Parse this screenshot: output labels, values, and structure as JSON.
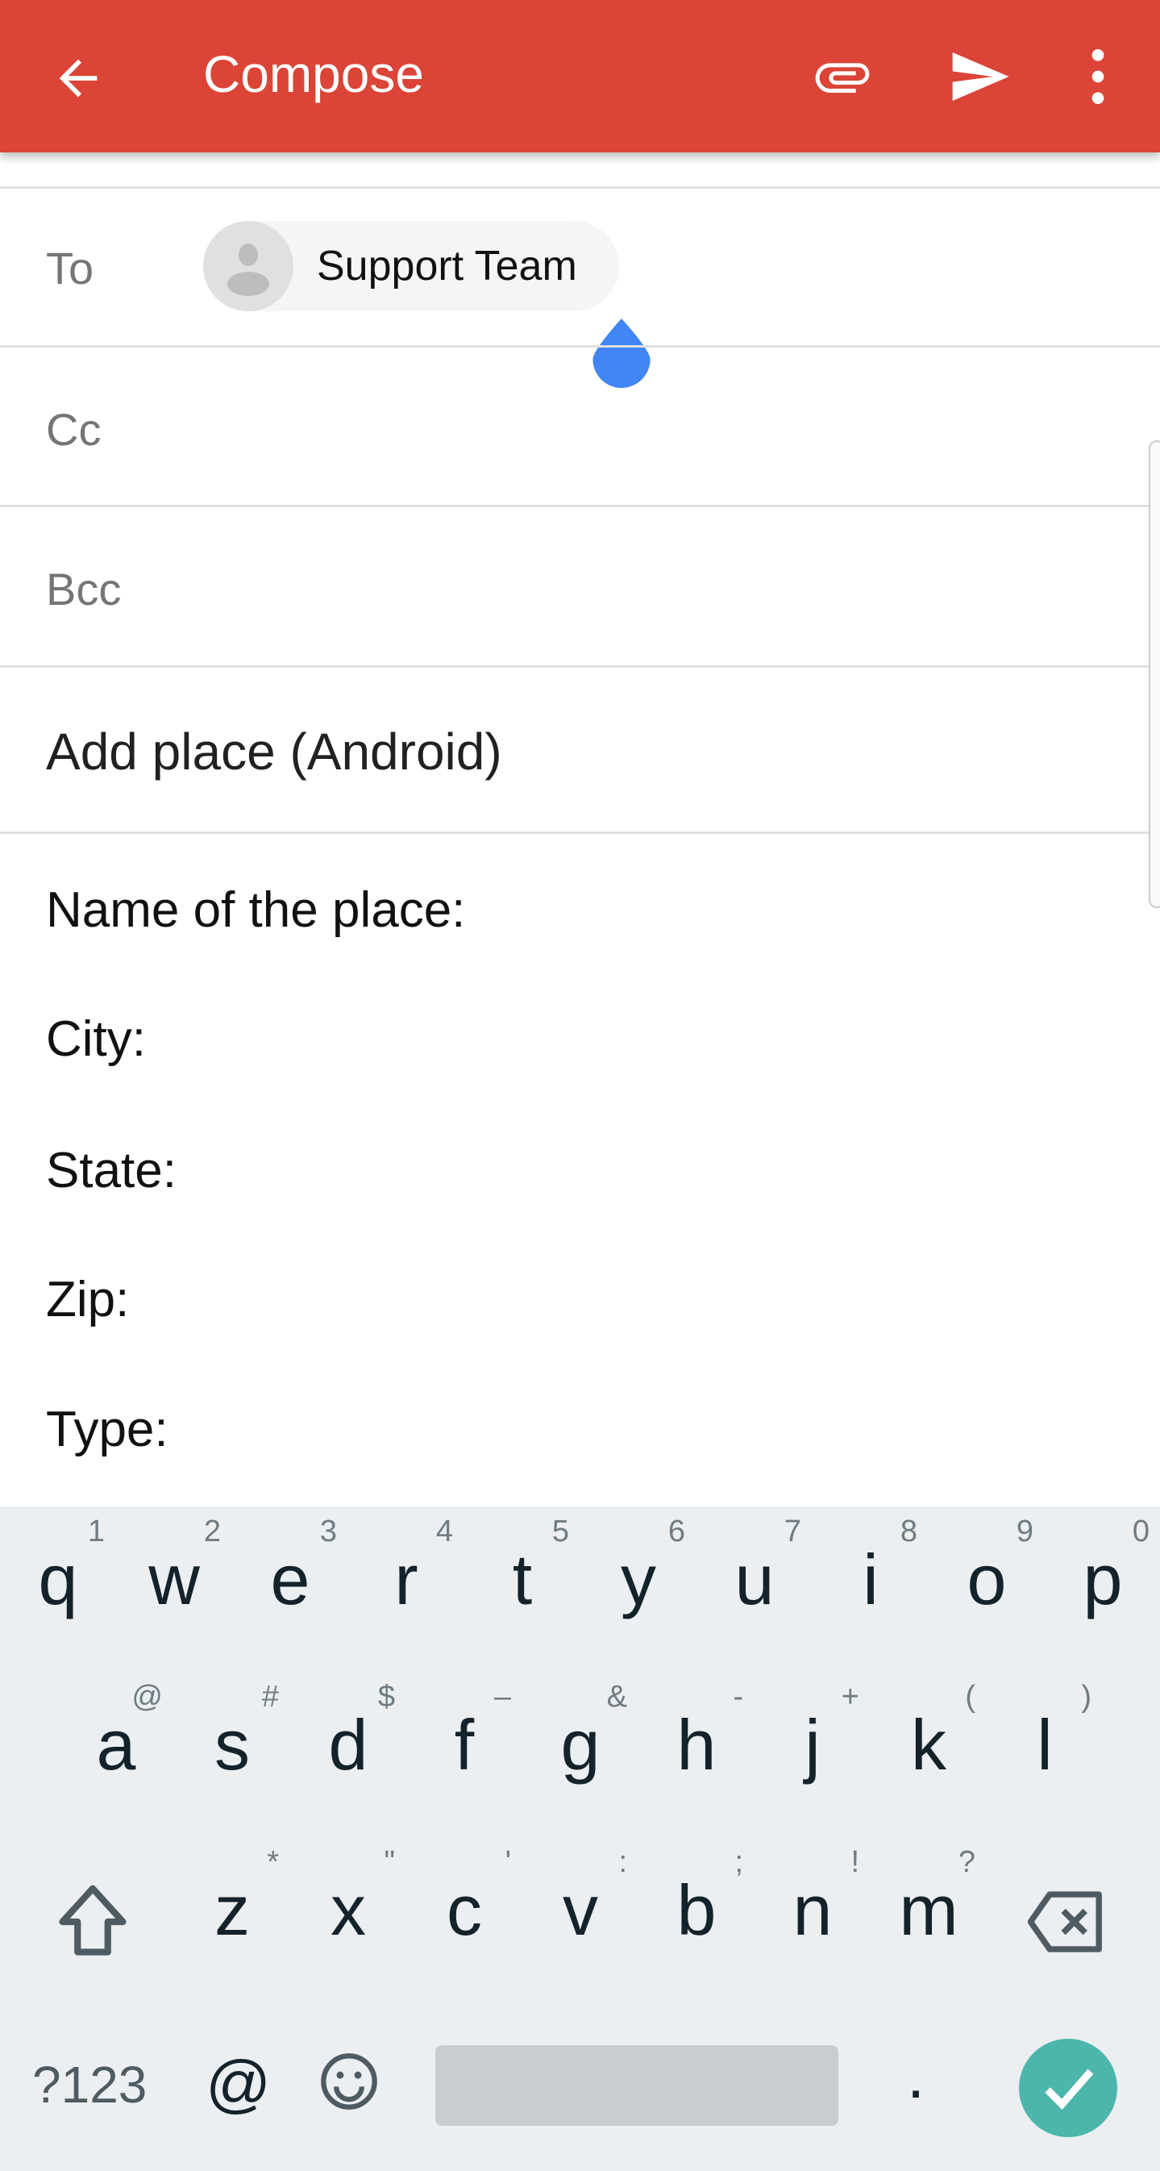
{
  "appbar": {
    "title": "Compose",
    "color": "#db4437",
    "icons": [
      "back-arrow-icon",
      "paperclip-icon",
      "send-icon",
      "more-vert-icon"
    ]
  },
  "fields": {
    "to_label": "To",
    "cc_label": "Cc",
    "bcc_label": "Bcc",
    "to_chip": "Support Team"
  },
  "subject": "Add place (Android)",
  "body_lines": [
    "Name of the place:",
    "City:",
    "State:",
    "Zip:",
    "Type:"
  ],
  "keyboard": {
    "row1": [
      {
        "k": "q",
        "h": "1"
      },
      {
        "k": "w",
        "h": "2"
      },
      {
        "k": "e",
        "h": "3"
      },
      {
        "k": "r",
        "h": "4"
      },
      {
        "k": "t",
        "h": "5"
      },
      {
        "k": "y",
        "h": "6"
      },
      {
        "k": "u",
        "h": "7"
      },
      {
        "k": "i",
        "h": "8"
      },
      {
        "k": "o",
        "h": "9"
      },
      {
        "k": "p",
        "h": "0"
      }
    ],
    "row2": [
      {
        "k": "a",
        "h": "@"
      },
      {
        "k": "s",
        "h": "#"
      },
      {
        "k": "d",
        "h": "$"
      },
      {
        "k": "f",
        "h": "–"
      },
      {
        "k": "g",
        "h": "&"
      },
      {
        "k": "h",
        "h": "-"
      },
      {
        "k": "j",
        "h": "+"
      },
      {
        "k": "k",
        "h": "("
      },
      {
        "k": "l",
        "h": ")"
      }
    ],
    "row3": [
      {
        "k": "z",
        "h": "*"
      },
      {
        "k": "x",
        "h": "\""
      },
      {
        "k": "c",
        "h": "'"
      },
      {
        "k": "v",
        "h": ":"
      },
      {
        "k": "b",
        "h": ";"
      },
      {
        "k": "n",
        "h": "!"
      },
      {
        "k": "m",
        "h": "?"
      }
    ],
    "symbols_label": "?123",
    "at_label": "@",
    "period_label": ".",
    "enter_color": "#4db6ac"
  }
}
